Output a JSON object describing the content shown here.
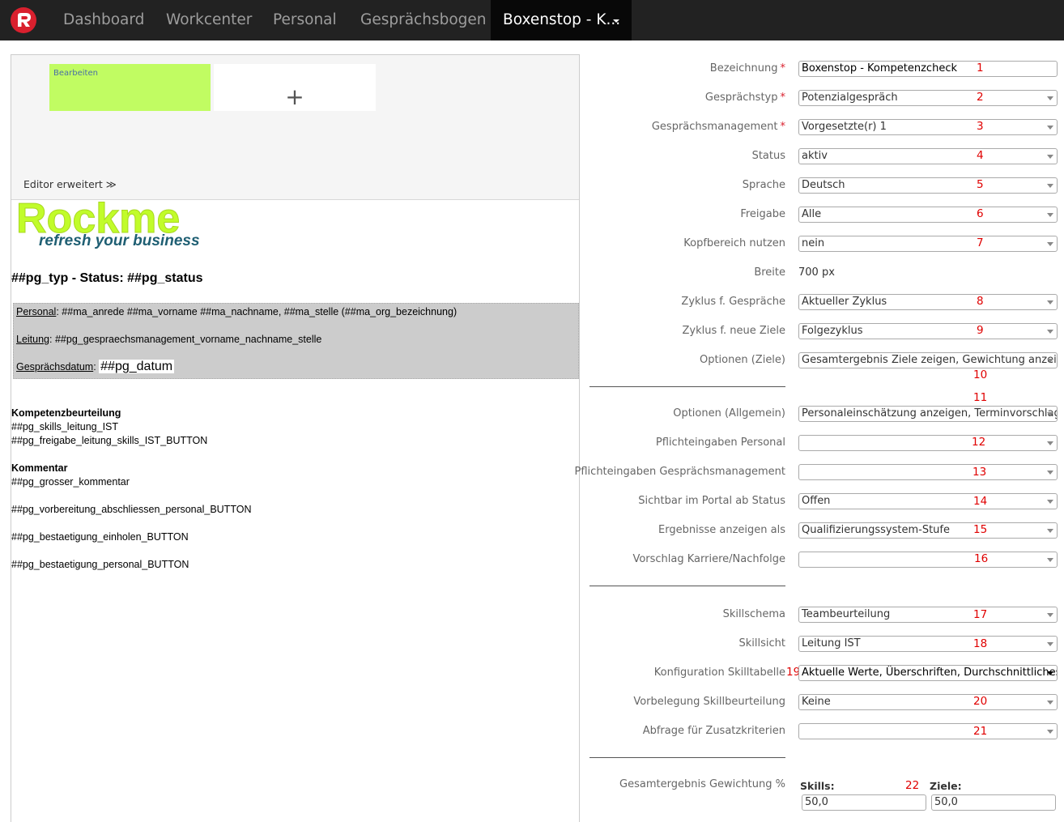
{
  "nav": {
    "items": [
      "Dashboard",
      "Workcenter",
      "Personal",
      "Gesprächsbogen"
    ],
    "active": "Boxenstop - K...",
    "logo_icon": "rockme-logo-icon"
  },
  "editor": {
    "tile_edit_label": "Bearbeiten",
    "tile_add_label": "+",
    "extended_label": "Editor erweitert ≫",
    "document": {
      "logo_text": "Rockme",
      "logo_tagline": "refresh your business",
      "title": "##pg_typ - Status: ##pg_status",
      "info": {
        "personal_label": "Personal",
        "personal_value": ": ##ma_anrede ##ma_vorname ##ma_nachname, ##ma_stelle (##ma_org_bezeichnung)",
        "leitung_label": "Leitung",
        "leitung_value": ": ##pg_gespraechsmanagement_vorname_nachname_stelle",
        "datum_label": "Gesprächsdatum",
        "datum_sep": ":",
        "datum_value": "##pg_datum"
      },
      "lines": [
        "Kompetenzbeurteilung",
        "##pg_skills_leitung_IST",
        "##pg_freigabe_leitung_skills_IST_BUTTON",
        "Kommentar",
        "##pg_grosser_kommentar",
        "##pg_vorbereitung_abschliessen_personal_BUTTON",
        "##pg_bestaetigung_einholen_BUTTON",
        "##pg_bestaetigung_personal_BUTTON"
      ]
    }
  },
  "form": {
    "fields": [
      {
        "label": "Bezeichnung",
        "required": "*",
        "value": "Boxenstop - Kompetenzcheck",
        "num": "1"
      },
      {
        "label": "Gesprächstyp",
        "required": "*",
        "value": "Potenzialgespräch",
        "num": "2"
      },
      {
        "label": "Gesprächsmanagement",
        "required": "*",
        "value": "Vorgesetzte(r) 1",
        "num": "3"
      },
      {
        "label": "Status",
        "value": "aktiv",
        "num": "4"
      },
      {
        "label": "Sprache",
        "value": "Deutsch",
        "num": "5"
      },
      {
        "label": "Freigabe",
        "value": "Alle",
        "num": "6"
      },
      {
        "label": "Kopfbereich nutzen",
        "value": "nein",
        "num": "7"
      },
      {
        "label": "Breite",
        "value": "700 px"
      },
      {
        "label": "Zyklus f. Gespräche",
        "value": "Aktueller Zyklus",
        "num": "8"
      },
      {
        "label": "Zyklus f. neue Ziele",
        "value": "Folgezyklus",
        "num": "9"
      },
      {
        "label": "Optionen (Ziele)",
        "value": "Gesamtergebnis Ziele zeigen, Gewichtung anzeig",
        "num": "10"
      },
      {
        "label": "Optionen (Allgemein)",
        "value": "Personaleinschätzung anzeigen, Terminvorschlag",
        "num": "11"
      },
      {
        "label": "Pflichteingaben Personal",
        "value": "",
        "num": "12"
      },
      {
        "label": "Pflichteingaben Gesprächsmanagement",
        "value": "",
        "num": "13"
      },
      {
        "label": "Sichtbar im Portal ab Status",
        "value": "Offen",
        "num": "14"
      },
      {
        "label": "Ergebnisse anzeigen als",
        "value": "Qualifizierungssystem-Stufe",
        "num": "15"
      },
      {
        "label": "Vorschlag Karriere/Nachfolge",
        "value": "",
        "num": "16"
      },
      {
        "label": "Skillschema",
        "value": "Teambeurteilung",
        "num": "17"
      },
      {
        "label": "Skillsicht",
        "value": "Leitung IST",
        "num": "18"
      },
      {
        "label": "Konfiguration Skilltabelle",
        "value": "Aktuelle Werte, Überschriften, Durchschnittliches",
        "num": "19"
      },
      {
        "label": "Vorbelegung Skillbeurteilung",
        "value": "Keine",
        "num": "20"
      },
      {
        "label": "Abfrage für Zusatzkriterien",
        "value": "",
        "num": "21"
      }
    ],
    "weighting": {
      "label": "Gesamtergebnis Gewichtung %",
      "num": "22",
      "skills_label": "Skills:",
      "skills_value": "50,0",
      "ziele_label": "Ziele:",
      "ziele_value": "50,0"
    }
  }
}
